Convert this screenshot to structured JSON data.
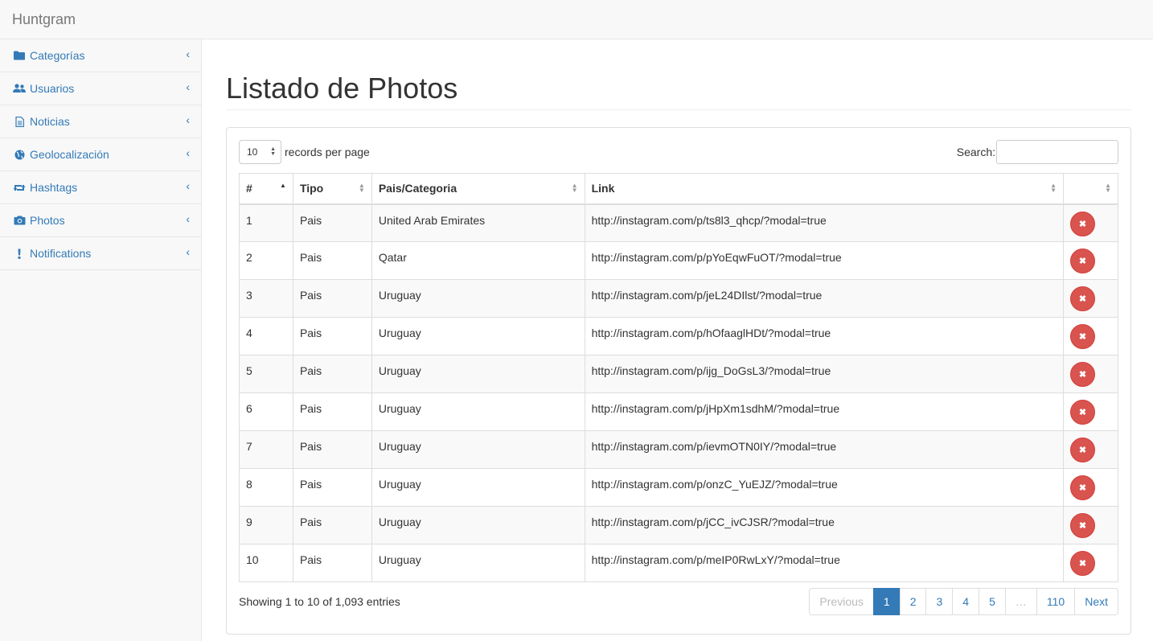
{
  "app": {
    "brand": "Huntgram"
  },
  "sidebar": {
    "items": [
      {
        "label": "Categorías",
        "icon": "folder-icon"
      },
      {
        "label": "Usuarios",
        "icon": "users-icon"
      },
      {
        "label": "Noticias",
        "icon": "file-icon"
      },
      {
        "label": "Geolocalización",
        "icon": "globe-icon"
      },
      {
        "label": "Hashtags",
        "icon": "retweet-icon"
      },
      {
        "label": "Photos",
        "icon": "camera-icon"
      },
      {
        "label": "Notifications",
        "icon": "exclamation-icon"
      }
    ]
  },
  "page": {
    "title": "Listado de Photos"
  },
  "table_controls": {
    "length_value": "10",
    "length_label": "records per page",
    "search_label": "Search:",
    "search_value": ""
  },
  "table": {
    "headers": [
      "#",
      "Tipo",
      "Pais/Categoria",
      "Link",
      ""
    ],
    "rows": [
      {
        "id": "1",
        "tipo": "Pais",
        "pais": "United Arab Emirates",
        "link": "http://instagram.com/p/ts8l3_qhcp/?modal=true"
      },
      {
        "id": "2",
        "tipo": "Pais",
        "pais": "Qatar",
        "link": "http://instagram.com/p/pYoEqwFuOT/?modal=true"
      },
      {
        "id": "3",
        "tipo": "Pais",
        "pais": "Uruguay",
        "link": "http://instagram.com/p/jeL24DIlst/?modal=true"
      },
      {
        "id": "4",
        "tipo": "Pais",
        "pais": "Uruguay",
        "link": "http://instagram.com/p/hOfaaglHDt/?modal=true"
      },
      {
        "id": "5",
        "tipo": "Pais",
        "pais": "Uruguay",
        "link": "http://instagram.com/p/ijg_DoGsL3/?modal=true"
      },
      {
        "id": "6",
        "tipo": "Pais",
        "pais": "Uruguay",
        "link": "http://instagram.com/p/jHpXm1sdhM/?modal=true"
      },
      {
        "id": "7",
        "tipo": "Pais",
        "pais": "Uruguay",
        "link": "http://instagram.com/p/ievmOTN0IY/?modal=true"
      },
      {
        "id": "8",
        "tipo": "Pais",
        "pais": "Uruguay",
        "link": "http://instagram.com/p/onzC_YuEJZ/?modal=true"
      },
      {
        "id": "9",
        "tipo": "Pais",
        "pais": "Uruguay",
        "link": "http://instagram.com/p/jCC_ivCJSR/?modal=true"
      },
      {
        "id": "10",
        "tipo": "Pais",
        "pais": "Uruguay",
        "link": "http://instagram.com/p/meIP0RwLxY/?modal=true"
      }
    ]
  },
  "footer": {
    "info": "Showing 1 to 10 of 1,093 entries",
    "pager": [
      "Previous",
      "1",
      "2",
      "3",
      "4",
      "5",
      "…",
      "110",
      "Next"
    ],
    "active_page": "1"
  },
  "colors": {
    "accent": "#337ab7",
    "danger": "#d9534f"
  }
}
